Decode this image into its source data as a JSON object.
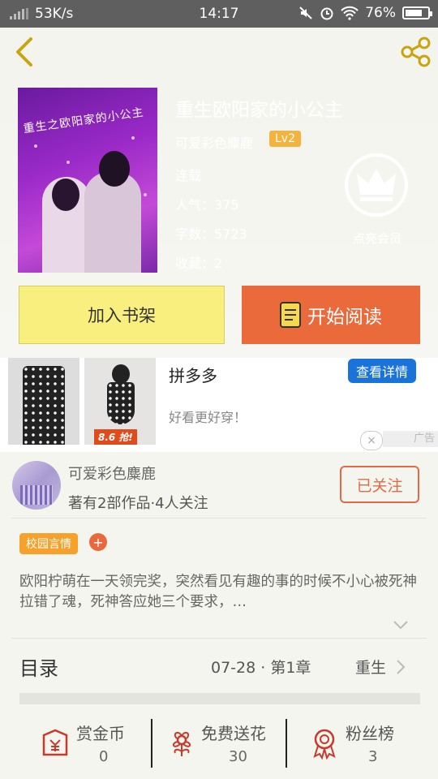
{
  "status_bar": {
    "speed": "53K/s",
    "time": "14:17",
    "battery": "76%",
    "battery_level": 0.76
  },
  "book": {
    "cover_text": "重生之欧阳家的小公主",
    "title": "重生欧阳家的小公主",
    "author": "可爱彩色麋鹿",
    "level": "Lv2",
    "status": "连载",
    "popularity": "人气：375",
    "word_count": "字数：5723",
    "favorites": "收藏：2"
  },
  "vip": {
    "label": "点亮会员"
  },
  "actions": {
    "add_shelf": "加入书架",
    "start_read": "开始阅读"
  },
  "ad": {
    "brand": "拼多多",
    "slogan": "好看更好穿！",
    "button": "查看详情",
    "price_badge": "8.6 抢!",
    "close": "×",
    "tag": "广告"
  },
  "author_info": {
    "name": "可爱彩色麋鹿",
    "stats": "著有2部作品·4人关注",
    "follow_button": "已关注"
  },
  "tags": {
    "genre": "校园言情",
    "add": "+"
  },
  "description": "欧阳柠萌在一天领完奖，突然看见有趣的事的时候不小心被死神拉错了魂，死神答应她三个要求，…",
  "toc": {
    "label": "目录",
    "date_chapter": "07-28 · 第1章",
    "latest": "重生"
  },
  "bottom_bar": [
    {
      "label": "赏金币",
      "value": "0"
    },
    {
      "label": "免费送花",
      "value": "30"
    },
    {
      "label": "粉丝榜",
      "value": "3"
    }
  ],
  "colors": {
    "accent": "#ea6a3b",
    "shelf_button": "#f9ef7e",
    "tag": "#f5a12a",
    "ad_button": "#1a73d9",
    "level_badge": "#f3b33c"
  }
}
